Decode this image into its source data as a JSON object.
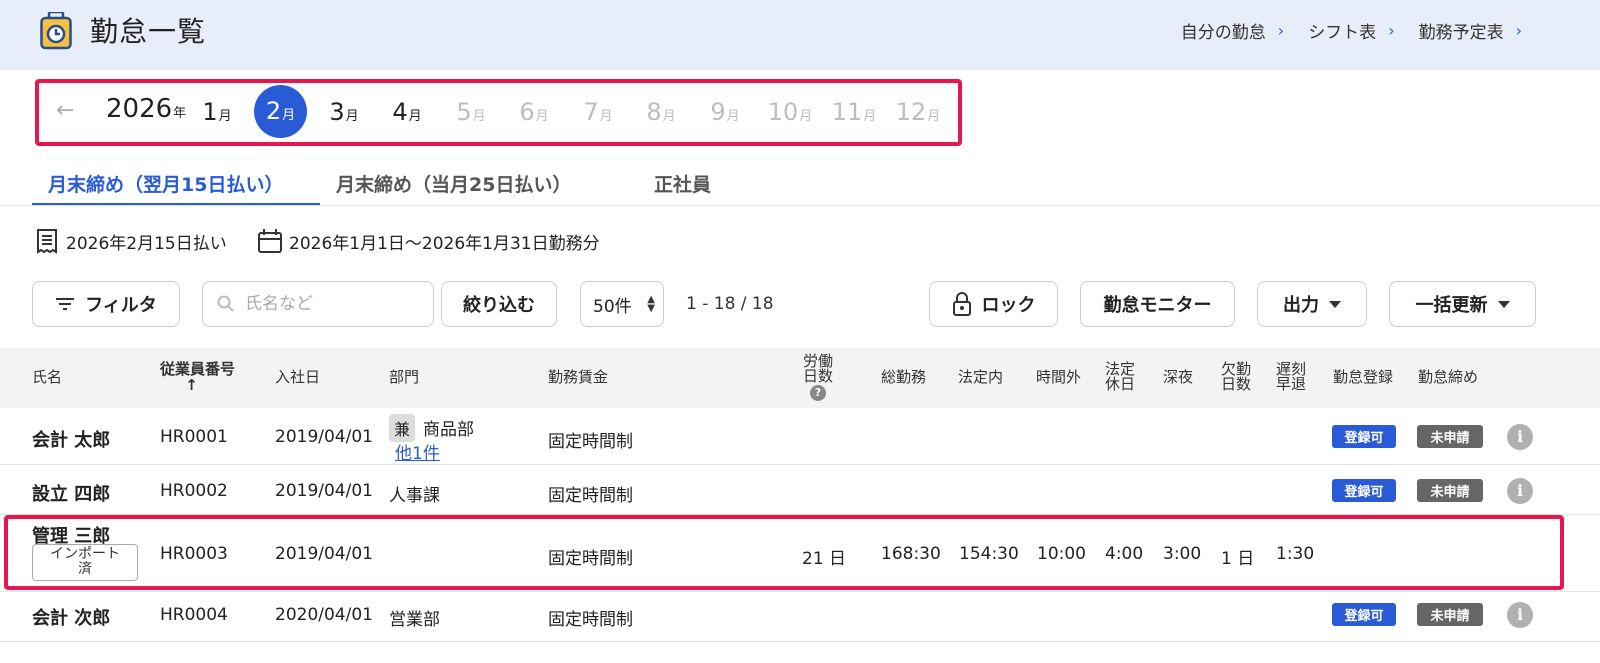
{
  "header": {
    "title": "勤怠一覧",
    "nav": [
      "自分の勤怠",
      "シフト表",
      "勤務予定表"
    ]
  },
  "month_picker": {
    "year": "2026",
    "year_suffix": "年",
    "month_suffix": "月",
    "months": [
      "1",
      "2",
      "3",
      "4",
      "5",
      "6",
      "7",
      "8",
      "9",
      "10",
      "11",
      "12"
    ],
    "selected": "2"
  },
  "tabs": [
    "月末締め（翌月15日払い）",
    "月末締め（当月25日払い）",
    "正社員"
  ],
  "info": {
    "payday": "2026年2月15日払い",
    "period": "2026年1月1日～2026年1月31日勤務分"
  },
  "toolbar": {
    "filter": "フィルタ",
    "search_placeholder": "氏名など",
    "narrow": "絞り込む",
    "page_size": "50件",
    "range": "1 - 18 / 18",
    "lock": "ロック",
    "monitor": "勤怠モニター",
    "export": "出力",
    "bulk": "一括更新"
  },
  "table": {
    "headers": {
      "name": "氏名",
      "emp_no": "従業員番号",
      "sort_arrow": "↑",
      "hire": "入社日",
      "dept": "部門",
      "wage": "勤務賃金",
      "labor_days_1": "労働",
      "labor_days_2": "日数",
      "help": "?",
      "total": "総勤務",
      "legal": "法定内",
      "overtime": "時間外",
      "holiday_1": "法定",
      "holiday_2": "休日",
      "night": "深夜",
      "absent_1": "欠勤",
      "absent_2": "日数",
      "late_1": "遅刻",
      "late_2": "早退",
      "reg": "勤怠登録",
      "close": "勤怠締め"
    },
    "rows": [
      {
        "name": "会計 太郎",
        "emp_no": "HR0001",
        "hire": "2019/04/01",
        "dept_tag": "兼",
        "dept": "商品部",
        "dept_more": "他1件",
        "wage": "固定時間制",
        "reg": "登録可",
        "close": "未申請"
      },
      {
        "name": "設立 四郎",
        "emp_no": "HR0002",
        "hire": "2019/04/01",
        "dept": "人事課",
        "wage": "固定時間制",
        "reg": "登録可",
        "close": "未申請"
      },
      {
        "name": "管理 三郎",
        "import_1": "インポート",
        "import_2": "済",
        "emp_no": "HR0003",
        "hire": "2019/04/01",
        "wage": "固定時間制",
        "labor_days": "21 日",
        "total": "168:30",
        "legal": "154:30",
        "overtime": "10:00",
        "holiday": "4:00",
        "night": "3:00",
        "absent": "1 日",
        "late": "1:30"
      },
      {
        "name": "会計 次郎",
        "emp_no": "HR0004",
        "hire": "2020/04/01",
        "dept": "営業部",
        "wage": "固定時間制",
        "reg": "登録可",
        "close": "未申請"
      }
    ]
  },
  "colors": {
    "accent": "#2a5bd7",
    "highlight": "#e8164f",
    "header_bg": "#e8eef9"
  }
}
